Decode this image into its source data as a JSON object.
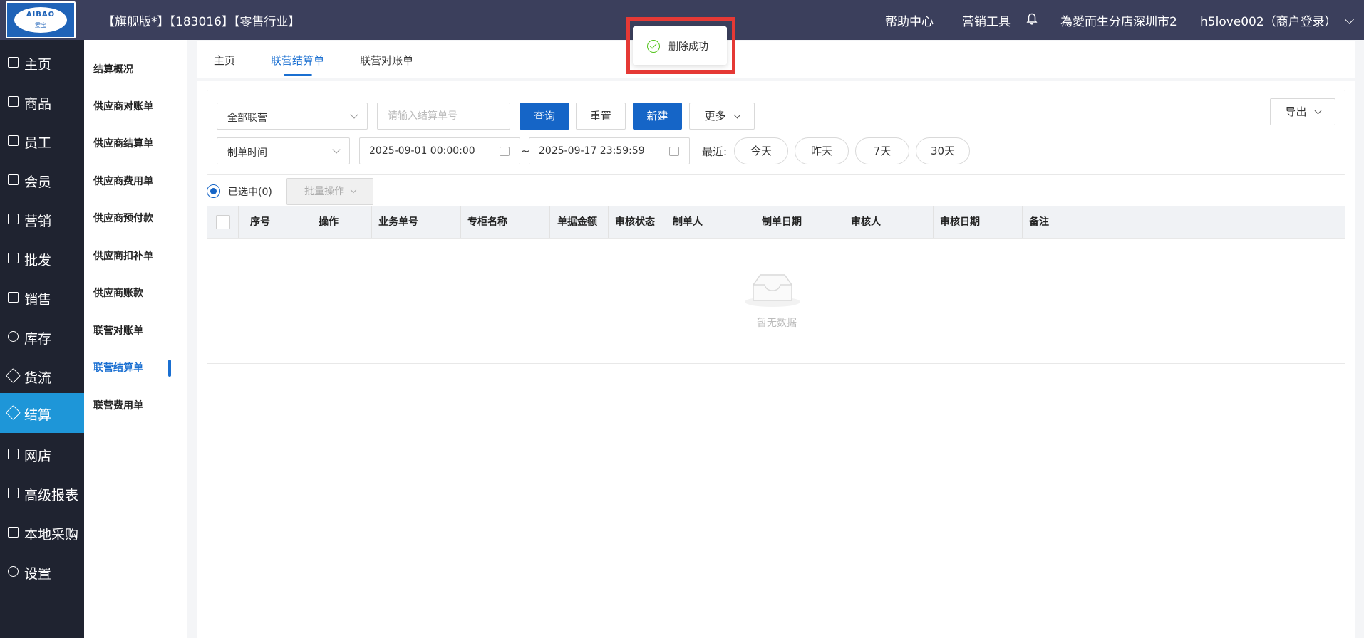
{
  "header": {
    "logo_text": "AIBAO",
    "logo_sub": "爱宝",
    "title": "【旗舰版*】【183016】【零售行业】",
    "nav": {
      "help": "帮助中心",
      "marketing_tools": "营销工具",
      "store": "為愛而生分店深圳市2",
      "user": "h5love002（商户登录）"
    }
  },
  "toast": {
    "message": "删除成功"
  },
  "sidebar": {
    "items": [
      {
        "label": "主页"
      },
      {
        "label": "商品"
      },
      {
        "label": "员工"
      },
      {
        "label": "会员"
      },
      {
        "label": "营销"
      },
      {
        "label": "批发"
      },
      {
        "label": "销售"
      },
      {
        "label": "库存"
      },
      {
        "label": "货流"
      },
      {
        "label": "结算"
      },
      {
        "label": "网店"
      },
      {
        "label": "高级报表"
      },
      {
        "label": "本地采购"
      },
      {
        "label": "设置"
      }
    ],
    "active": "结算"
  },
  "subnav": {
    "items": [
      {
        "label": "结算概况"
      },
      {
        "label": "供应商对账单"
      },
      {
        "label": "供应商结算单"
      },
      {
        "label": "供应商费用单"
      },
      {
        "label": "供应商预付款"
      },
      {
        "label": "供应商扣补单"
      },
      {
        "label": "供应商账款"
      },
      {
        "label": "联营对账单"
      },
      {
        "label": "联营结算单"
      },
      {
        "label": "联营费用单"
      }
    ],
    "active": "联营结算单"
  },
  "tabs": [
    {
      "label": "主页"
    },
    {
      "label": "联营结算单"
    },
    {
      "label": "联营对账单"
    }
  ],
  "filters": {
    "joint_select": "全部联营",
    "settlement_no_placeholder": "请输入结算单号",
    "query": "查询",
    "reset": "重置",
    "new": "新建",
    "more": "更多",
    "export": "导出",
    "time_type": "制单时间",
    "date_start": "2025-09-01 00:00:00",
    "date_sep": "~",
    "date_end": "2025-09-17 23:59:59",
    "recent_label": "最近:",
    "quick": [
      "今天",
      "昨天",
      "7天",
      "30天"
    ]
  },
  "selection": {
    "selected_label": "已选中(0)",
    "batch": "批量操作"
  },
  "table": {
    "columns": [
      "序号",
      "操作",
      "业务单号",
      "专柜名称",
      "单据金额",
      "审核状态",
      "制单人",
      "制单日期",
      "审核人",
      "审核日期",
      "备注"
    ],
    "empty_text": "暂无数据"
  },
  "colors": {
    "topbar": "#3b3f5c",
    "sidebar": "#1f2330",
    "active_side": "#1e96d8",
    "primary": "#1565c7",
    "highlight": "#e53935",
    "success": "#52c41a"
  }
}
